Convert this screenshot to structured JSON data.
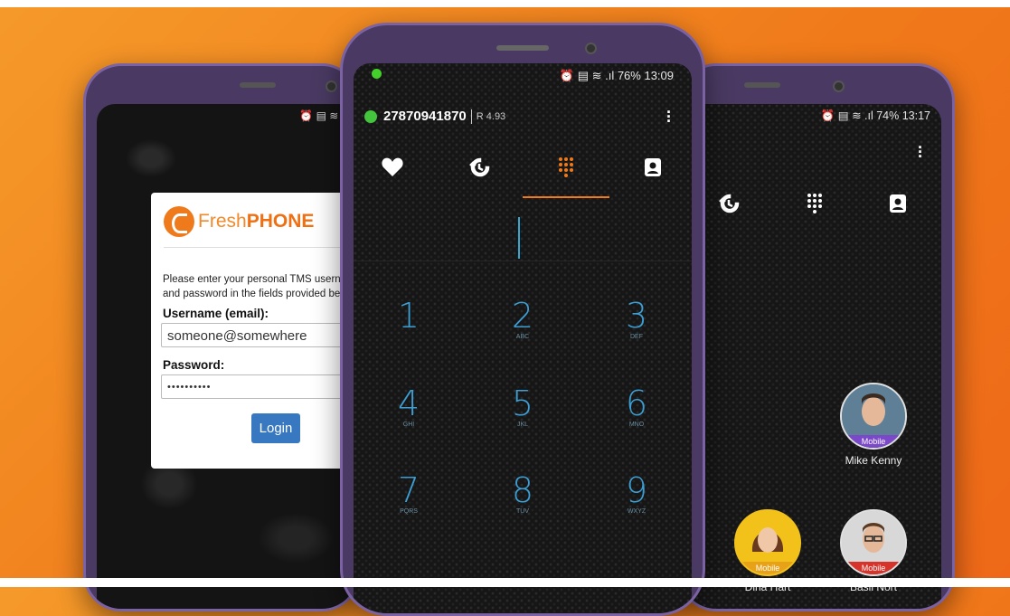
{
  "left_phone": {
    "brand_fresh": "Fresh",
    "brand_phone": "PHONE",
    "intro_line1": "Please enter your personal TMS usern",
    "intro_line2": "and password in the fields provided be",
    "username_label": "Username (email):",
    "username_value": "someone@somewhere",
    "password_label": "Password:",
    "password_value": "••••••••••",
    "login_label": "Login"
  },
  "mid_phone": {
    "status": "76% 13:09",
    "account_number": "27870941870",
    "balance": "R 4.93",
    "keys": [
      {
        "num": "1",
        "letters": ""
      },
      {
        "num": "2",
        "letters": "ABC"
      },
      {
        "num": "3",
        "letters": "DEF"
      },
      {
        "num": "4",
        "letters": "GHI"
      },
      {
        "num": "5",
        "letters": "JKL"
      },
      {
        "num": "6",
        "letters": "MNO"
      },
      {
        "num": "7",
        "letters": "PQRS"
      },
      {
        "num": "8",
        "letters": "TUV"
      },
      {
        "num": "9",
        "letters": "WXYZ"
      }
    ]
  },
  "right_phone": {
    "status": "74% 13:17",
    "contacts": [
      {
        "name": "Mike Kenny",
        "type": "Mobile",
        "badge_color": "#7a48c8",
        "ring": "#e0e0e0"
      },
      {
        "name": "Dina Hart",
        "type": "Mobile",
        "badge_color": "#e8a21a",
        "ring": "#f2c21a"
      },
      {
        "name": "Basil Nort",
        "type": "Mobile",
        "badge_color": "#d8332a",
        "ring": "#e0e0e0"
      }
    ]
  },
  "colors": {
    "accent": "#ef7a1c",
    "dial_blue": "#3d9ed3",
    "login_blue": "#3778c0"
  },
  "icons": [
    "heart-icon",
    "history-icon",
    "dialpad-icon",
    "contacts-icon",
    "more-vert-icon"
  ]
}
